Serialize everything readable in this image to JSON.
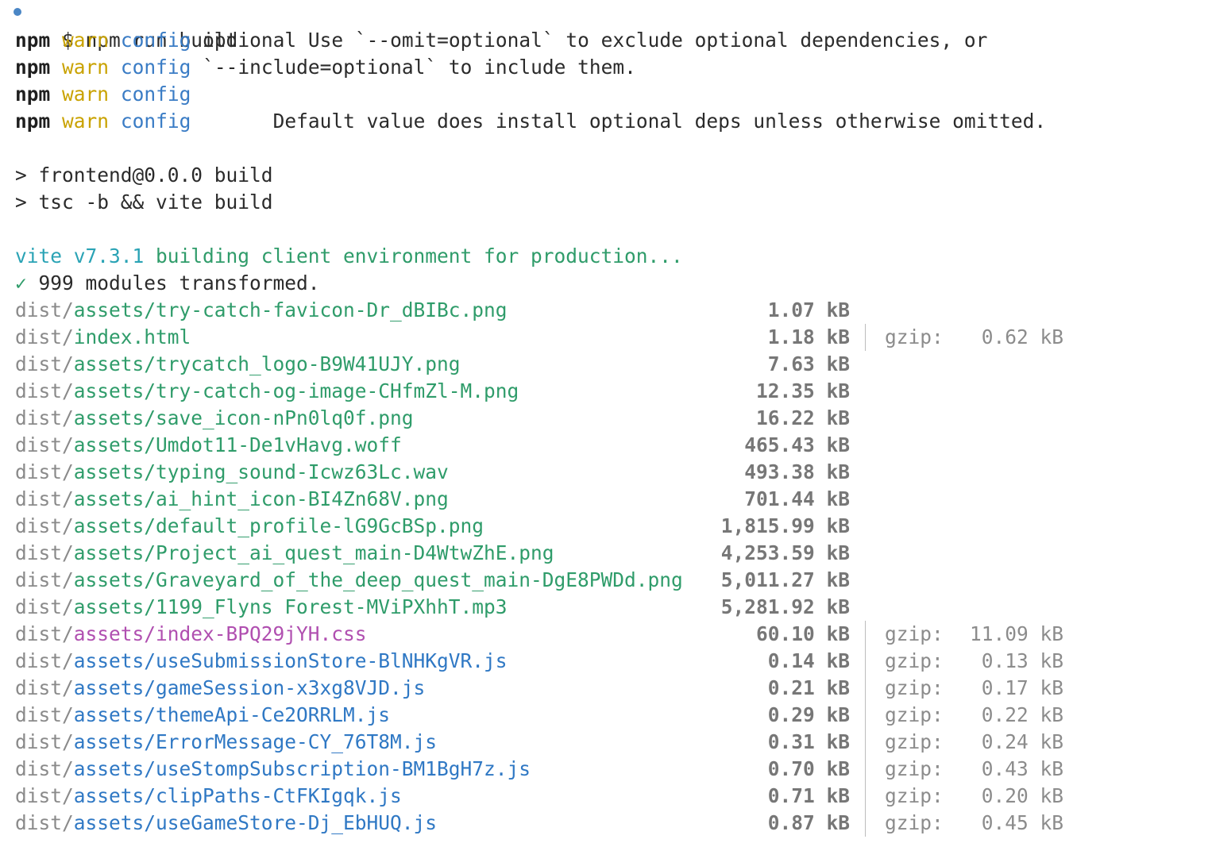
{
  "command": {
    "prompt_symbol": "$",
    "text": "npm run build"
  },
  "warnings": [
    {
      "npm": "npm",
      "level": "warn",
      "source": "config",
      "message": "optional Use `--omit=optional` to exclude optional dependencies, or"
    },
    {
      "npm": "npm",
      "level": "warn",
      "source": "config",
      "message": "`--include=optional` to include them."
    },
    {
      "npm": "npm",
      "level": "warn",
      "source": "config",
      "message": ""
    },
    {
      "npm": "npm",
      "level": "warn",
      "source": "config",
      "message": "      Default value does install optional deps unless otherwise omitted."
    }
  ],
  "scripts": [
    "> frontend@0.0.0 build",
    "> tsc -b && vite build"
  ],
  "vite": {
    "version_text": "vite v7.3.1",
    "env_text": "building client environment for production...",
    "check": "✓",
    "modules_text": "999 modules transformed."
  },
  "gzip_label": "gzip:",
  "files": [
    {
      "prefix": "dist/",
      "name": "assets/try-catch-favicon-Dr_dBIBc.png",
      "kind": "asset",
      "size": "1.07 kB",
      "gzip": ""
    },
    {
      "prefix": "dist/",
      "name": "index.html",
      "kind": "asset",
      "size": "1.18 kB",
      "gzip": "0.62 kB"
    },
    {
      "prefix": "dist/",
      "name": "assets/trycatch_logo-B9W41UJY.png",
      "kind": "asset",
      "size": "7.63 kB",
      "gzip": ""
    },
    {
      "prefix": "dist/",
      "name": "assets/try-catch-og-image-CHfmZl-M.png",
      "kind": "asset",
      "size": "12.35 kB",
      "gzip": ""
    },
    {
      "prefix": "dist/",
      "name": "assets/save_icon-nPn0lq0f.png",
      "kind": "asset",
      "size": "16.22 kB",
      "gzip": ""
    },
    {
      "prefix": "dist/",
      "name": "assets/Umdot11-De1vHavg.woff",
      "kind": "asset",
      "size": "465.43 kB",
      "gzip": ""
    },
    {
      "prefix": "dist/",
      "name": "assets/typing_sound-Icwz63Lc.wav",
      "kind": "asset",
      "size": "493.38 kB",
      "gzip": ""
    },
    {
      "prefix": "dist/",
      "name": "assets/ai_hint_icon-BI4Zn68V.png",
      "kind": "asset",
      "size": "701.44 kB",
      "gzip": ""
    },
    {
      "prefix": "dist/",
      "name": "assets/default_profile-lG9GcBSp.png",
      "kind": "asset",
      "size": "1,815.99 kB",
      "gzip": ""
    },
    {
      "prefix": "dist/",
      "name": "assets/Project_ai_quest_main-D4WtwZhE.png",
      "kind": "asset",
      "size": "4,253.59 kB",
      "gzip": ""
    },
    {
      "prefix": "dist/",
      "name": "assets/Graveyard_of_the_deep_quest_main-DgE8PWDd.png",
      "kind": "asset",
      "size": "5,011.27 kB",
      "gzip": ""
    },
    {
      "prefix": "dist/",
      "name": "assets/1199_Flyns Forest-MViPXhhT.mp3",
      "kind": "asset",
      "size": "5,281.92 kB",
      "gzip": ""
    },
    {
      "prefix": "dist/",
      "name": "assets/index-BPQ29jYH.css",
      "kind": "css",
      "size": "60.10 kB",
      "gzip": "11.09 kB"
    },
    {
      "prefix": "dist/",
      "name": "assets/useSubmissionStore-BlNHKgVR.js",
      "kind": "js",
      "size": "0.14 kB",
      "gzip": "0.13 kB"
    },
    {
      "prefix": "dist/",
      "name": "assets/gameSession-x3xg8VJD.js",
      "kind": "js",
      "size": "0.21 kB",
      "gzip": "0.17 kB"
    },
    {
      "prefix": "dist/",
      "name": "assets/themeApi-Ce2ORRLM.js",
      "kind": "js",
      "size": "0.29 kB",
      "gzip": "0.22 kB"
    },
    {
      "prefix": "dist/",
      "name": "assets/ErrorMessage-CY_76T8M.js",
      "kind": "js",
      "size": "0.31 kB",
      "gzip": "0.24 kB"
    },
    {
      "prefix": "dist/",
      "name": "assets/useStompSubscription-BM1BgH7z.js",
      "kind": "js",
      "size": "0.70 kB",
      "gzip": "0.43 kB"
    },
    {
      "prefix": "dist/",
      "name": "assets/clipPaths-CtFKIgqk.js",
      "kind": "js",
      "size": "0.71 kB",
      "gzip": "0.20 kB"
    },
    {
      "prefix": "dist/",
      "name": "assets/useGameStore-Dj_EbHUQ.js",
      "kind": "js",
      "size": "0.87 kB",
      "gzip": "0.45 kB"
    }
  ]
}
